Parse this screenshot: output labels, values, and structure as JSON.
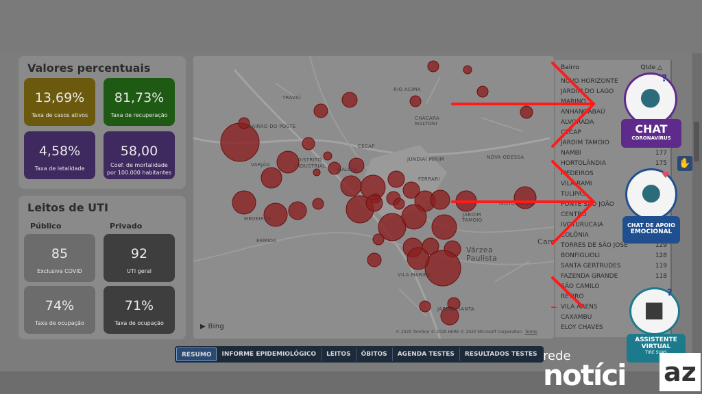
{
  "percent_panel": {
    "title": "Valores percentuais",
    "cards": [
      {
        "value": "13,69%",
        "label": "Taxa de casos ativos",
        "color": "#6b5a0e"
      },
      {
        "value": "81,73%",
        "label": "Taxa de recuperação",
        "color": "#1e5a14"
      },
      {
        "value": "4,58%",
        "label": "Taxa de letalidade",
        "color": "#3f2a60"
      },
      {
        "value": "58,00",
        "label": "Coef. de mortalidade",
        "label2": "por 100.000 habitantes",
        "color": "#3f2a60"
      }
    ]
  },
  "uti_panel": {
    "title": "Leitos de UTI",
    "public_label": "Público",
    "private_label": "Privado",
    "cards": [
      {
        "value": "85",
        "label": "Exclusiva COVID"
      },
      {
        "value": "92",
        "label": "UTI geral"
      },
      {
        "value": "74%",
        "label": "Taxa de ocupação"
      },
      {
        "value": "71%",
        "label": "Taxa de ocupação"
      }
    ]
  },
  "map": {
    "labels": [
      "TRAVIÚ",
      "RIO ACIMA",
      "CHÁCARA",
      "MALTONI",
      "BAIRRO DO POSTE",
      "VARJÃO",
      "DISTRITO",
      "INDUSTRIAL",
      "CECAP",
      "JUNDIAÍ MIRIM",
      "NOVA ODESSA",
      "MEDEIROS",
      "ERMIDA",
      "JARDIM",
      "TAMOIO",
      "Várzea",
      "Paulista",
      "VILA MARINA",
      "JARDIM SANTA",
      "IVOTURUCAIA",
      "Cam",
      "MALOTA",
      "FERRARI"
    ],
    "bing": "Bing",
    "copyright": "© 2020 TomTom © 2020 HERE © 2020 Microsoft Corporation",
    "terms": "Terms"
  },
  "table": {
    "col_bairro": "Bairro",
    "col_qtde": "Qtde",
    "rows": [
      {
        "name": "NOVO HORIZONTE",
        "qty": ""
      },
      {
        "name": "JARDIM DO LAGO",
        "qty": ""
      },
      {
        "name": "MARINO",
        "qty": ""
      },
      {
        "name": "ANHANGABAÚ",
        "qty": ""
      },
      {
        "name": "ALVORADA",
        "qty": ""
      },
      {
        "name": "CECAP",
        "qty": ""
      },
      {
        "name": "JARDIM TAMOIO",
        "qty": ""
      },
      {
        "name": "NAMBI",
        "qty": "177"
      },
      {
        "name": "HORTOLÂNDIA",
        "qty": "175"
      },
      {
        "name": "MEDEIROS",
        "qty": ""
      },
      {
        "name": "VILA RAMI",
        "qty": ""
      },
      {
        "name": "TULIPAS",
        "qty": ""
      },
      {
        "name": "PONTE SÃO JOÃO",
        "qty": ""
      },
      {
        "name": "CENTRO",
        "qty": ""
      },
      {
        "name": "IVOTURUCAIA",
        "qty": ""
      },
      {
        "name": "COLÔNIA",
        "qty": ""
      },
      {
        "name": "TORRES DE SÃO JOSÉ",
        "qty": "129"
      },
      {
        "name": "BONFIGLIOLI",
        "qty": "128"
      },
      {
        "name": "SANTA GERTRUDES",
        "qty": "119"
      },
      {
        "name": "FAZENDA GRANDE",
        "qty": "118"
      },
      {
        "name": "SÃO CAMILO",
        "qty": ""
      },
      {
        "name": "RETIRO",
        "qty": ""
      },
      {
        "name": "VILA ARENS",
        "qty": ""
      },
      {
        "name": "CAXAMBU",
        "qty": ""
      },
      {
        "name": "ELOY CHAVES",
        "qty": ""
      }
    ]
  },
  "tabs": [
    "RESUMO",
    "INFORME EPIDEMIOLÓGICO",
    "LEITOS",
    "ÓBITOS",
    "AGENDA TESTES",
    "RESULTADOS TESTES"
  ],
  "badges": {
    "chat": {
      "title": "CHAT",
      "subtitle": "CORONAVÍRUS"
    },
    "apoio": {
      "line1": "CHAT DE APOIO",
      "line2": "EMOCIONAL"
    },
    "assistente": {
      "line1": "ASSISTENTE",
      "line2": "VIRTUAL",
      "line3": "TIRE SUAS"
    }
  },
  "logo": {
    "top": "rede",
    "bottom": "notíci",
    "mark": "az"
  },
  "colors": {
    "bubble": "#8a1f1f",
    "arrow": "#ff1a1a",
    "badge_purple": "#5e2a8c",
    "badge_blue": "#1f4f8f",
    "badge_teal": "#1b7a8c"
  }
}
